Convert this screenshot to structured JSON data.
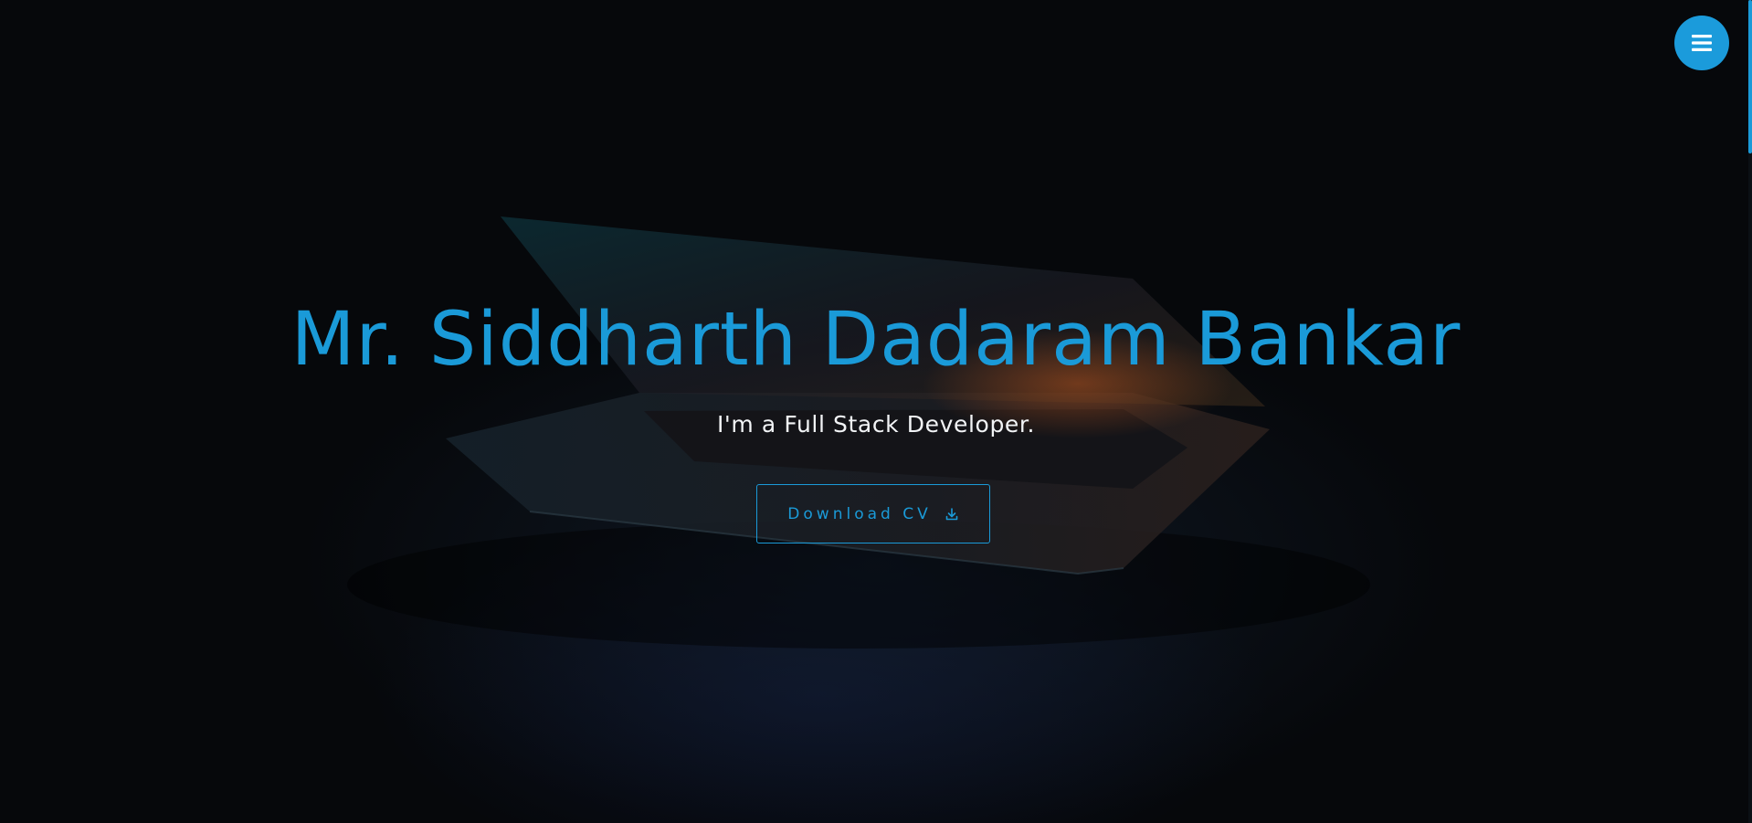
{
  "hero": {
    "title": "Mr. Siddharth Dadaram Bankar",
    "subtitle": "I'm a Full Stack Developer.",
    "cv_button_label": "Download CV",
    "cv_button_icon": "download-icon"
  },
  "nav": {
    "menu_icon": "hamburger-icon"
  },
  "colors": {
    "accent": "#1a9ad8",
    "background": "#06080b",
    "text": "#f2f4f6"
  }
}
